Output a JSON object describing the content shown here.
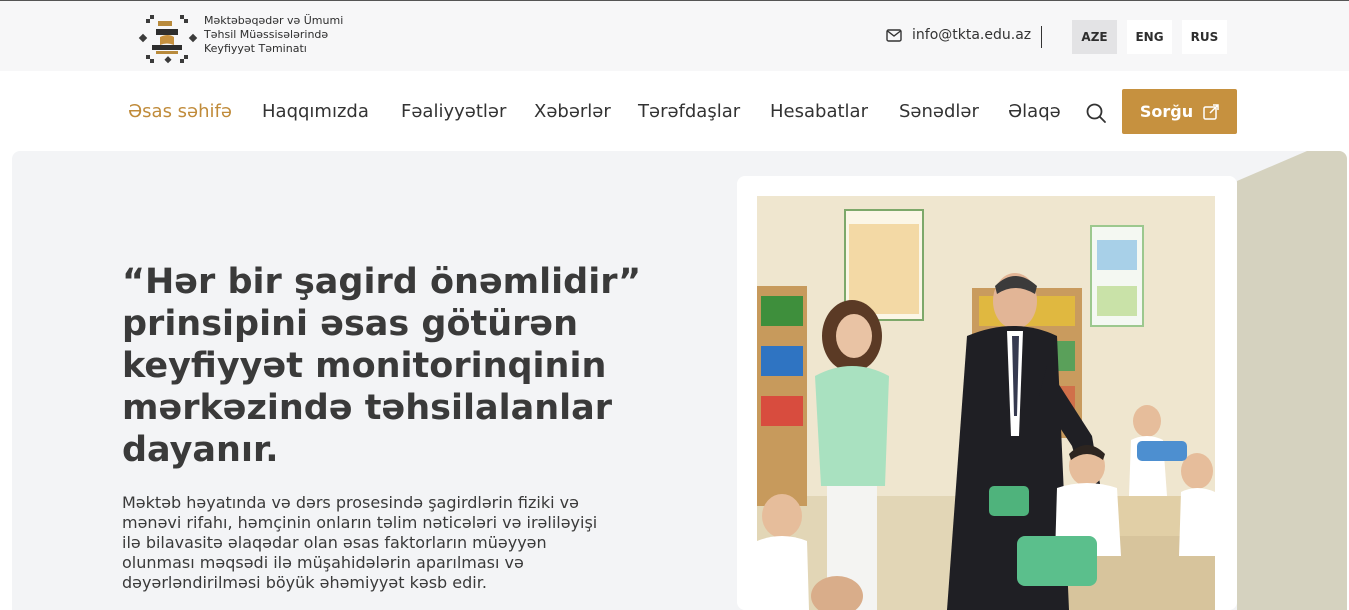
{
  "header": {
    "org_name_lines": [
      "Məktəbəqədər və Ümumi",
      "Təhsil Müəssisələrində",
      "Keyfiyyət Təminatı"
    ],
    "email": "info@tkta.edu.az",
    "languages": [
      {
        "label": "AZE",
        "active": true
      },
      {
        "label": "ENG",
        "active": false
      },
      {
        "label": "RUS",
        "active": false
      }
    ]
  },
  "nav": {
    "items": [
      "Əsas səhifə",
      "Haqqımızda",
      "Fəaliyyətlər",
      "Xəbərlər",
      "Tərəfdaşlar",
      "Hesabatlar",
      "Sənədlər",
      "Əlaqə"
    ],
    "active_index": 0,
    "cta_label": "Sorğu"
  },
  "hero": {
    "headline_lines": [
      "“Hər bir şagird önəmlidir”",
      "prinsipini əsas götürən",
      "keyfiyyət monitorinqinin",
      "mərkəzində təhsilalanlar",
      "dayanır."
    ],
    "lead_lines": [
      "Məktəb həyatında və dərs prosesində şagirdlərin fiziki və",
      "mənəvi rifahı, həmçinin onların təlim nəticələri və irəliləyişi",
      "ilə bilavasitə əlaqədar olan əsas faktorların müəyyən",
      "olunması məqsədi ilə müşahidələrin aparılması və",
      "dəyərləndirilməsi böyük əhəmiyyət kəsb edir."
    ]
  },
  "colors": {
    "accent": "#c6913f",
    "active_nav": "#c08b3a",
    "hero_bg": "#f3f4f6",
    "deco": "#d5d2bf"
  },
  "icons": {
    "logo": "logo-emblem",
    "email": "envelope-icon",
    "search": "search-icon",
    "cta": "external-link-icon"
  }
}
